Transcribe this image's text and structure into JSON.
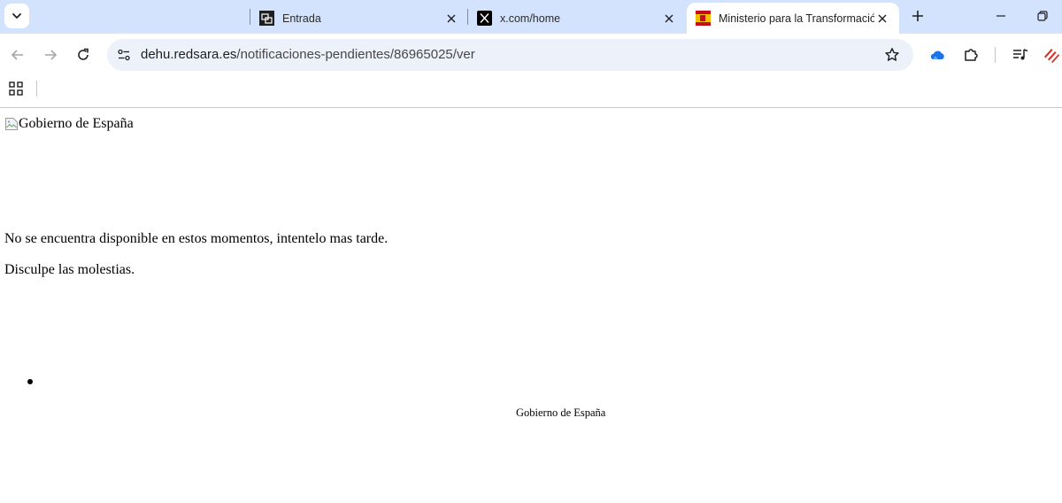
{
  "browser": {
    "tabs": [
      {
        "title": "Entrada",
        "favicon": "mail-icon",
        "active": false
      },
      {
        "title": "x.com/home",
        "favicon": "x-logo-icon",
        "active": false
      },
      {
        "title": "Ministerio para la Transformación",
        "favicon": "spain-gov-icon",
        "active": true
      }
    ],
    "address_bar": {
      "domain": "dehu.redsara.es",
      "path": "/notificaciones-pendientes/86965025/ver"
    }
  },
  "page": {
    "header_image_alt": "Gobierno de España",
    "message_line1": "No se encuentra disponible en estos momentos, intentelo mas tarde.",
    "message_line2": "Disculpe las molestias.",
    "footer_text": "Gobierno de España"
  },
  "colors": {
    "tabstrip_bg": "#d3e3fd",
    "omnibox_bg": "#edf2fa",
    "onedrive_blue": "#1a73e8",
    "ext_red": "#d93025"
  }
}
